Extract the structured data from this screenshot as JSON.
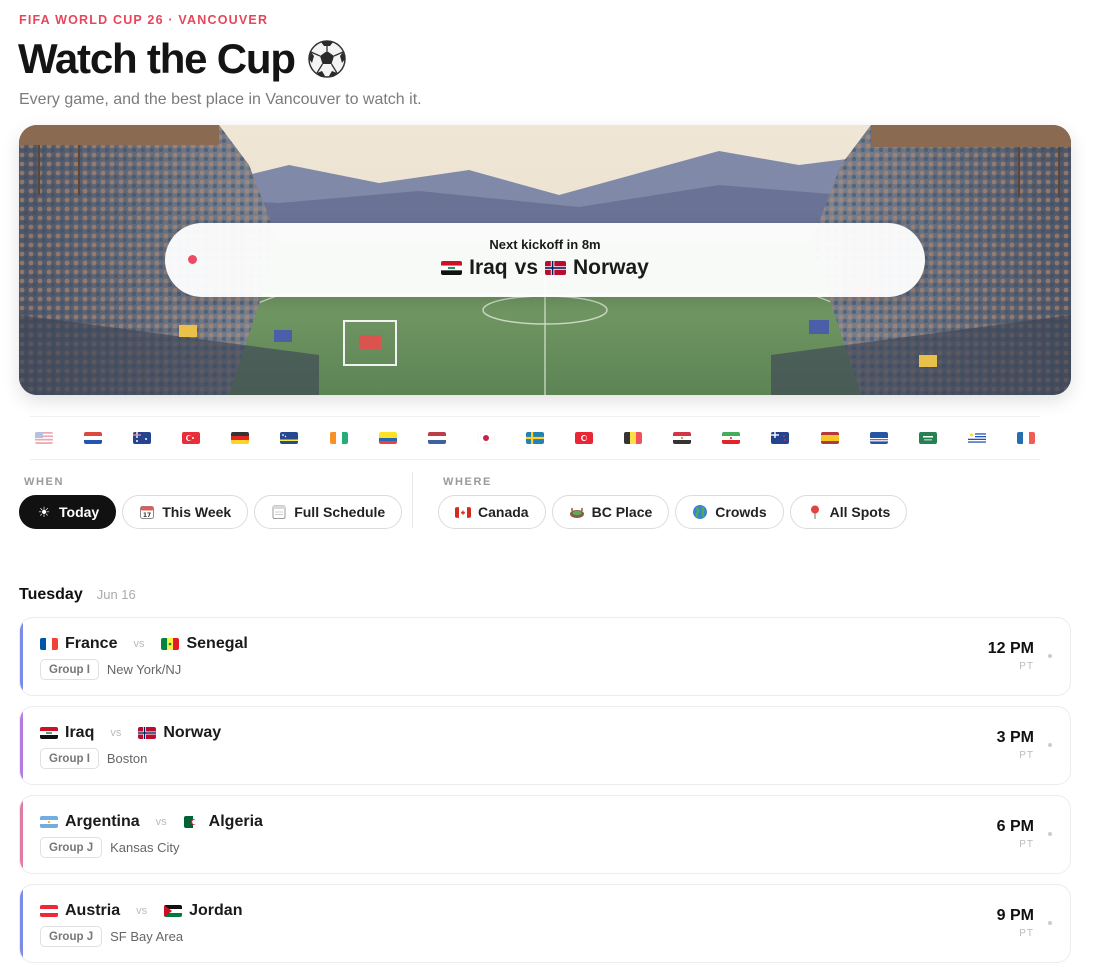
{
  "header": {
    "eyebrow": "FIFA WORLD CUP 26 · VANCOUVER",
    "title": "Watch the Cup",
    "subtitle": "Every game, and the best place in Vancouver to watch it."
  },
  "hero": {
    "kickoff_label": "Next kickoff in 8m",
    "home_team": "Iraq",
    "vs": "vs",
    "away_team": "Norway",
    "home_flag": "iraq-flag",
    "away_flag": "norway-flag"
  },
  "flag_filter": [
    "usa",
    "paraguay",
    "australia",
    "turkey",
    "germany",
    "curacao",
    "ivory-coast",
    "ecuador",
    "netherlands",
    "japan",
    "sweden",
    "tunisia",
    "belgium",
    "egypt",
    "iran",
    "new-zealand",
    "spain",
    "cape-verde",
    "saudi-arabia",
    "uruguay",
    "france"
  ],
  "when": {
    "label": "WHEN",
    "options": [
      {
        "icon": "sun-icon",
        "label": "Today",
        "active": true
      },
      {
        "icon": "calendar-icon",
        "label": "This Week",
        "active": false
      },
      {
        "icon": "schedule-icon",
        "label": "Full Schedule",
        "active": false
      }
    ]
  },
  "where": {
    "label": "WHERE",
    "options": [
      {
        "icon": "canada-flag-icon",
        "label": "Canada"
      },
      {
        "icon": "stadium-icon",
        "label": "BC Place"
      },
      {
        "icon": "globe-icon",
        "label": "Crowds"
      },
      {
        "icon": "pin-icon",
        "label": "All Spots"
      }
    ]
  },
  "schedule": {
    "day": "Tuesday",
    "date": "Jun 16",
    "matches": [
      {
        "home": "France",
        "home_flag": "france",
        "vs": "vs",
        "away": "Senegal",
        "away_flag": "senegal",
        "group": "Group I",
        "venue": "New York/NJ",
        "time": "12 PM",
        "tz": "PT",
        "accent": "#7b8ce8"
      },
      {
        "home": "Iraq",
        "home_flag": "iraq",
        "vs": "vs",
        "away": "Norway",
        "away_flag": "norway",
        "group": "Group I",
        "venue": "Boston",
        "time": "3 PM",
        "tz": "PT",
        "accent": "#b57be0"
      },
      {
        "home": "Argentina",
        "home_flag": "argentina",
        "vs": "vs",
        "away": "Algeria",
        "away_flag": "algeria",
        "group": "Group J",
        "venue": "Kansas City",
        "time": "6 PM",
        "tz": "PT",
        "accent": "#e07ba6"
      },
      {
        "home": "Austria",
        "home_flag": "austria",
        "vs": "vs",
        "away": "Jordan",
        "away_flag": "jordan",
        "group": "Group J",
        "venue": "SF Bay Area",
        "time": "9 PM",
        "tz": "PT",
        "accent": "#7b8ce8"
      }
    ]
  }
}
